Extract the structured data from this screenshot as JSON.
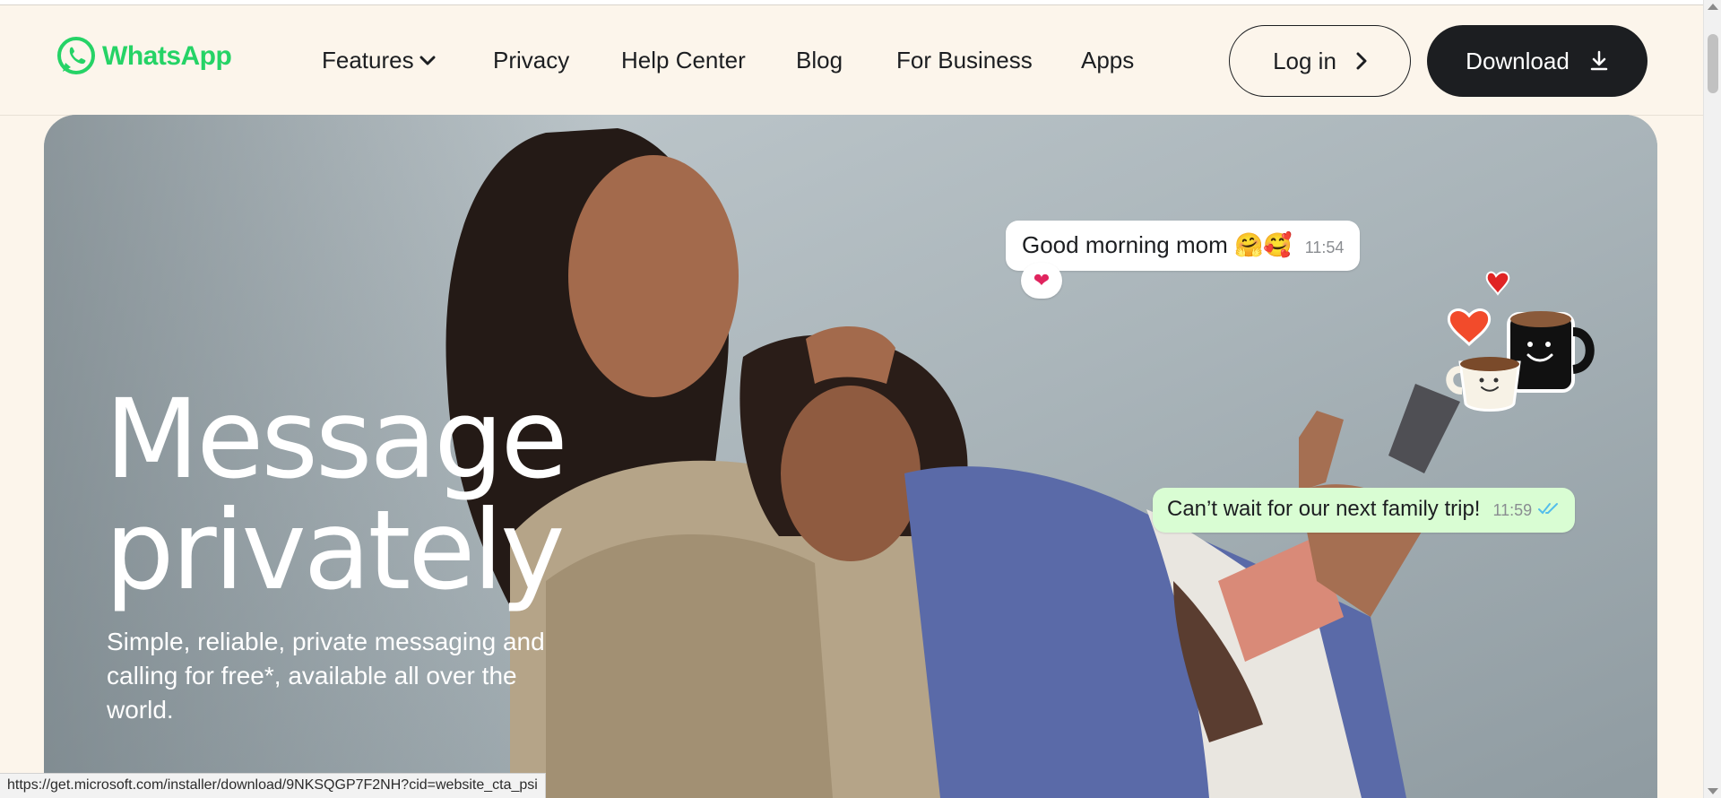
{
  "colors": {
    "brand_green": "#25d366",
    "header_bg": "#fcf5eb",
    "dark_button": "#1c1e21",
    "sent_bubble": "#d9fdd3",
    "read_ticks": "#53bdeb"
  },
  "header": {
    "logo_text": "WhatsApp",
    "logo_icon": "whatsapp-logo-icon",
    "nav": {
      "features": "Features",
      "privacy": "Privacy",
      "help_center": "Help Center",
      "blog": "Blog",
      "for_business": "For Business",
      "apps": "Apps"
    },
    "login_label": "Log in",
    "download_label": "Download"
  },
  "hero": {
    "title_line1": "Message",
    "title_line2": "privately",
    "subtitle": "Simple, reliable, private messaging and calling for free*, available all over the world.",
    "messages": [
      {
        "text": "Good morning mom 🤗🥰",
        "time": "11:54",
        "reaction": "❤"
      },
      {
        "text": "Can’t wait for our next family trip!",
        "time": "11:59",
        "status": "read"
      }
    ]
  },
  "status_bar": {
    "url": "https://get.microsoft.com/installer/download/9NKSQGP7F2NH?cid=website_cta_psi"
  }
}
